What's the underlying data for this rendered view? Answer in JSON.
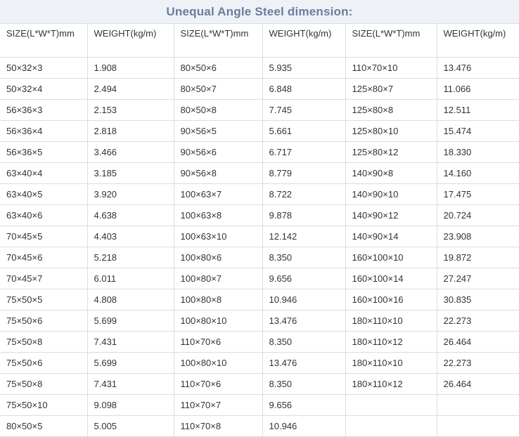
{
  "title": "Unequal Angle Steel dimension:",
  "headers": [
    "SIZE(L*W*T)mm",
    "WEIGHT(kg/m)",
    "SIZE(L*W*T)mm",
    "WEIGHT(kg/m)",
    "SIZE(L*W*T)mm",
    "WEIGHT(kg/m)"
  ],
  "rows": [
    [
      "50×32×3",
      "1.908",
      "80×50×6",
      "5.935",
      "110×70×10",
      "13.476"
    ],
    [
      "50×32×4",
      "2.494",
      "80×50×7",
      "6.848",
      "125×80×7",
      "11.066"
    ],
    [
      "56×36×3",
      "2.153",
      "80×50×8",
      "7.745",
      "125×80×8",
      "12.511"
    ],
    [
      "56×36×4",
      "2.818",
      "90×56×5",
      "5.661",
      "125×80×10",
      "15.474"
    ],
    [
      "56×36×5",
      "3.466",
      "90×56×6",
      "6.717",
      "125×80×12",
      "18.330"
    ],
    [
      "63×40×4",
      "3.185",
      "90×56×8",
      "8.779",
      "140×90×8",
      "14.160"
    ],
    [
      "63×40×5",
      "3.920",
      "100×63×7",
      "8.722",
      "140×90×10",
      "17.475"
    ],
    [
      "63×40×6",
      "4.638",
      "100×63×8",
      "9.878",
      "140×90×12",
      "20.724"
    ],
    [
      "70×45×5",
      "4.403",
      "100×63×10",
      "12.142",
      "140×90×14",
      "23.908"
    ],
    [
      "70×45×6",
      "5.218",
      "100×80×6",
      "8.350",
      "160×100×10",
      "19.872"
    ],
    [
      "70×45×7",
      "6.011",
      "100×80×7",
      "9.656",
      "160×100×14",
      "27.247"
    ],
    [
      "75×50×5",
      "4.808",
      "100×80×8",
      "10.946",
      "160×100×16",
      "30.835"
    ],
    [
      "75×50×6",
      "5.699",
      "100×80×10",
      "13.476",
      "180×110×10",
      "22.273"
    ],
    [
      "75×50×8",
      "7.431",
      "110×70×6",
      "8.350",
      "180×110×12",
      "26.464"
    ],
    [
      "75×50×6",
      "5.699",
      "100×80×10",
      "13.476",
      "180×110×10",
      "22.273"
    ],
    [
      "75×50×8",
      "7.431",
      "110×70×6",
      "8.350",
      "180×110×12",
      "26.464"
    ],
    [
      "75×50×10",
      "9.098",
      "110×70×7",
      "9.656",
      "",
      ""
    ],
    [
      "80×50×5",
      "5.005",
      "110×70×8",
      "10.946",
      "",
      ""
    ]
  ]
}
